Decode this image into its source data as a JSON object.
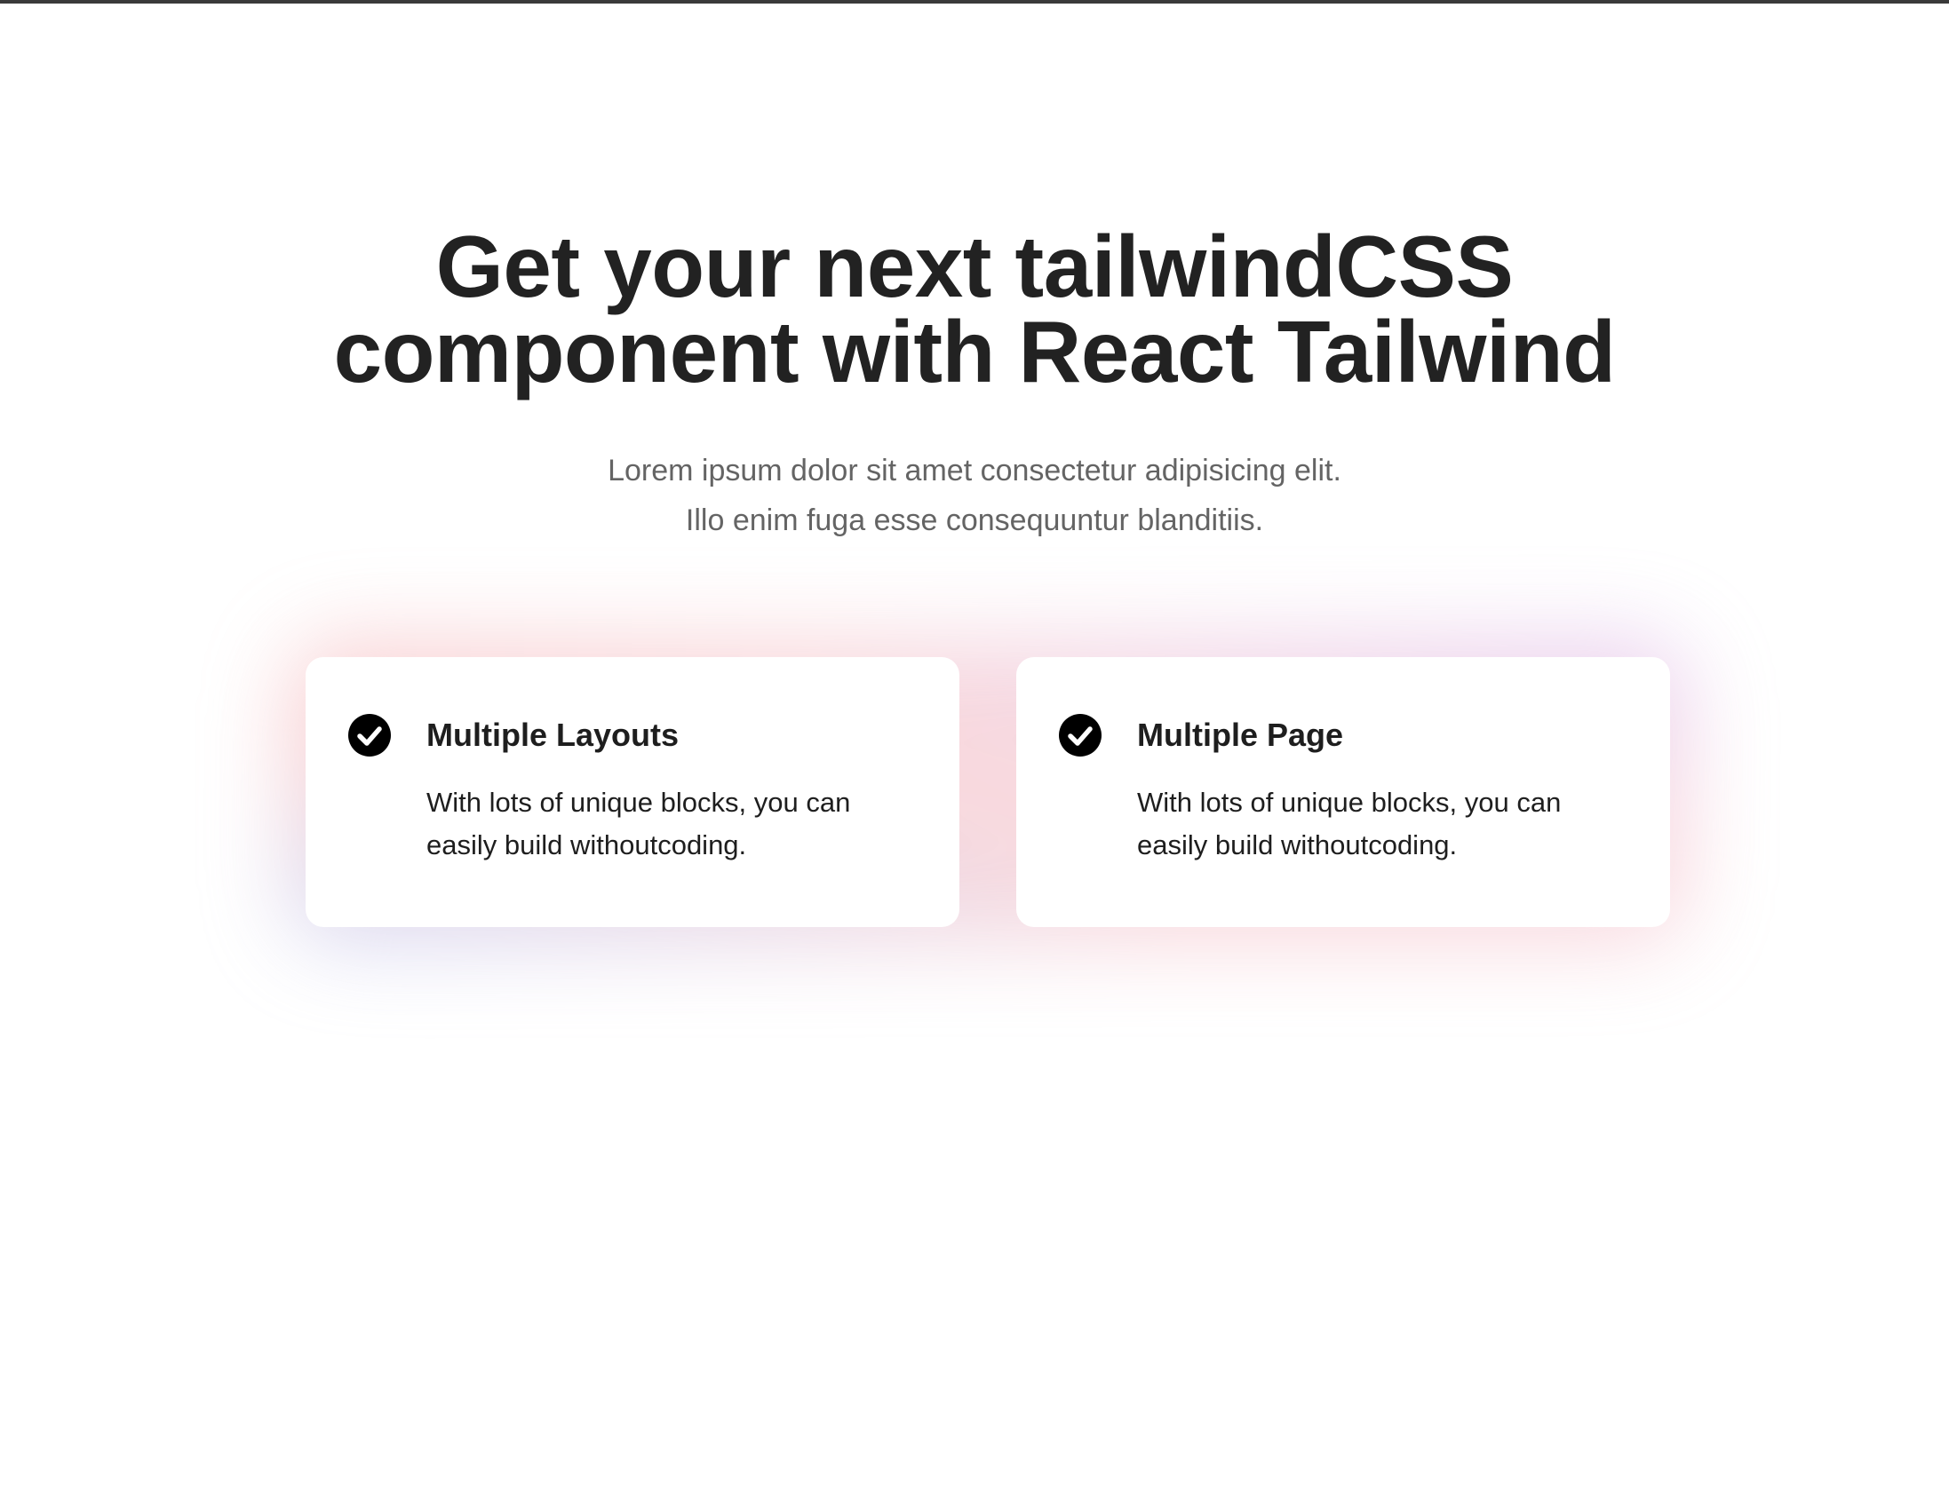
{
  "hero": {
    "title_line1": "Get your next tailwindCSS",
    "title_line2": "component with React Tailwind",
    "subtitle_line1": "Lorem ipsum dolor sit amet consectetur adipisicing elit.",
    "subtitle_line2": "Illo enim fuga esse consequuntur blanditiis."
  },
  "features": [
    {
      "icon": "check-circle-icon",
      "title": "Multiple Layouts",
      "description": "With lots of unique blocks, you can easily build withoutcoding."
    },
    {
      "icon": "check-circle-icon",
      "title": "Multiple Page",
      "description": "With lots of unique blocks, you can easily build withoutcoding."
    }
  ],
  "colors": {
    "heading": "#222222",
    "subtitle": "#646464",
    "card_background": "#ffffff",
    "glow_pink": "#f2a0a5",
    "glow_blue": "#aabef5",
    "glow_purple": "#d2aaeb"
  }
}
